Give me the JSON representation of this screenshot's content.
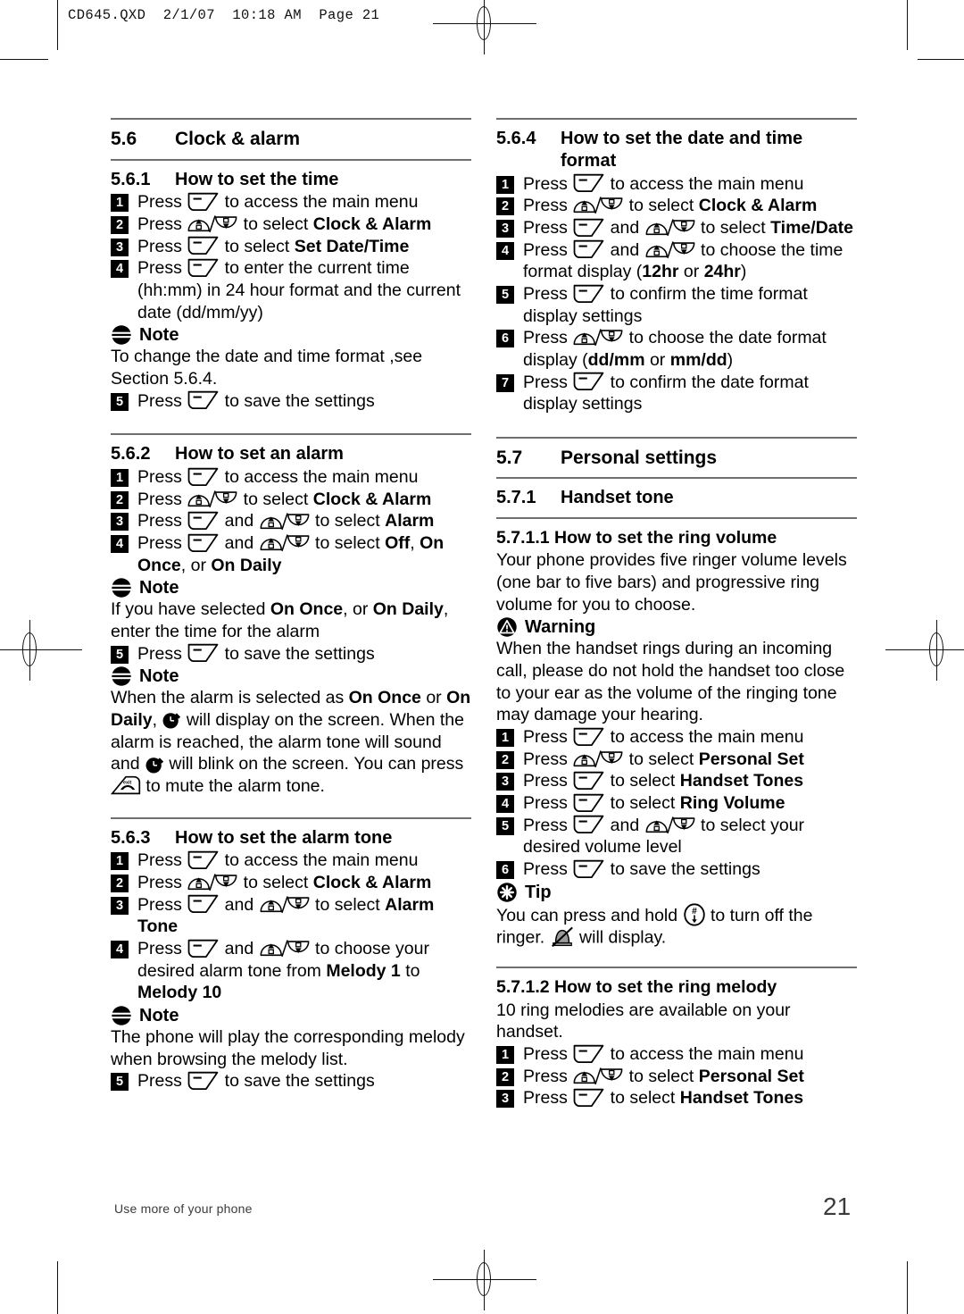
{
  "print_header": "CD645.QXD  2/1/07  10:18 AM  Page 21",
  "footer": {
    "left": "Use more of your phone",
    "page_number": "21"
  },
  "icons": {
    "soft_key": "soft-key-icon",
    "nav_up_down": "nav-up-down-key-icon",
    "clock": "alarm-clock-icon",
    "exit_key": "exit-key-icon",
    "hash_key": "hash-key-icon",
    "ringer_off": "ringer-off-icon",
    "note": "note-icon",
    "warning": "warning-icon",
    "tip": "tip-icon"
  },
  "left_column": {
    "section_56": {
      "number": "5.6",
      "title": "Clock & alarm"
    },
    "section_561": {
      "number": "5.6.1",
      "title": "How to set the time",
      "steps": [
        {
          "n": "1",
          "parts": [
            "Press ",
            "SOFT",
            " to access the main menu"
          ]
        },
        {
          "n": "2",
          "parts": [
            "Press ",
            "NAV",
            " to select ",
            "B:Clock & Alarm"
          ]
        },
        {
          "n": "3",
          "parts": [
            "Press ",
            "SOFT",
            " to select ",
            "B:Set Date/Time"
          ]
        },
        {
          "n": "4",
          "parts": [
            "Press ",
            "SOFT",
            " to enter the current time (hh:mm) in 24 hour format and the current date (dd/mm/yy)"
          ]
        }
      ],
      "note": {
        "label": "Note",
        "text": "To change the date and time format ,see Section 5.6.4."
      },
      "steps_after_note": [
        {
          "n": "5",
          "parts": [
            "Press ",
            "SOFT",
            " to save the settings"
          ]
        }
      ]
    },
    "section_562": {
      "number": "5.6.2",
      "title": "How to set an alarm",
      "steps": [
        {
          "n": "1",
          "parts": [
            "Press ",
            "SOFT",
            " to access the main menu"
          ]
        },
        {
          "n": "2",
          "parts": [
            "Press ",
            "NAV",
            " to select ",
            "B:Clock & Alarm"
          ]
        },
        {
          "n": "3",
          "parts": [
            "Press ",
            "SOFT",
            " and ",
            "NAV",
            " to select ",
            "B:Alarm"
          ]
        },
        {
          "n": "4",
          "parts": [
            "Press ",
            "SOFT",
            " and ",
            "NAV",
            " to select ",
            "B:Off",
            ", ",
            "B:On Once",
            ", or ",
            "B:On Daily"
          ]
        }
      ],
      "note1": {
        "label": "Note",
        "text_parts": [
          "If you have selected ",
          "B:On Once",
          ", or ",
          "B:On Daily",
          ", enter the time for the alarm"
        ]
      },
      "steps_after_note1": [
        {
          "n": "5",
          "parts": [
            "Press ",
            "SOFT",
            " to save the settings"
          ]
        }
      ],
      "note2": {
        "label": "Note",
        "text_parts": [
          "When the alarm is selected as ",
          "B:On Once",
          " or ",
          "B:On Daily",
          ", ",
          "CLOCK",
          " will display on the screen. When the alarm is reached, the alarm tone will sound and ",
          "CLOCK",
          " will blink on the screen. You can press ",
          "EXIT",
          " to mute the alarm tone."
        ]
      }
    },
    "section_563": {
      "number": "5.6.3",
      "title": "How to set the alarm tone",
      "steps": [
        {
          "n": "1",
          "parts": [
            "Press ",
            "SOFT",
            " to access the main menu"
          ]
        },
        {
          "n": "2",
          "parts": [
            "Press ",
            "NAV",
            " to select ",
            "B:Clock & Alarm"
          ]
        },
        {
          "n": "3",
          "parts": [
            "Press ",
            "SOFT",
            " and ",
            "NAV",
            " to select ",
            "B:Alarm Tone"
          ]
        },
        {
          "n": "4",
          "parts": [
            "Press ",
            "SOFT",
            " and ",
            "NAV",
            " to choose your desired alarm tone from ",
            "B:Melody 1",
            " to ",
            "B:Melody 10"
          ]
        }
      ],
      "note": {
        "label": "Note",
        "text": "The phone will play the corresponding melody when browsing the melody list."
      },
      "steps_after_note": [
        {
          "n": "5",
          "parts": [
            "Press ",
            "SOFT",
            " to save the settings"
          ]
        }
      ]
    }
  },
  "right_column": {
    "section_564": {
      "number": "5.6.4",
      "title": "How to set the date and time format",
      "steps": [
        {
          "n": "1",
          "parts": [
            "Press ",
            "SOFT",
            " to access the main menu"
          ]
        },
        {
          "n": "2",
          "parts": [
            "Press ",
            "NAV",
            " to select ",
            "B:Clock & Alarm"
          ]
        },
        {
          "n": "3",
          "parts": [
            "Press ",
            "SOFT",
            " and ",
            "NAV",
            " to select ",
            "B:Time/Date"
          ]
        },
        {
          "n": "4",
          "parts": [
            "Press ",
            "SOFT",
            " and ",
            "NAV",
            " to choose the time format display (",
            "B:12hr",
            " or ",
            "B:24hr",
            ")"
          ]
        },
        {
          "n": "5",
          "parts": [
            "Press ",
            "SOFT",
            " to confirm the time format display settings"
          ]
        },
        {
          "n": "6",
          "parts": [
            "Press ",
            "NAV",
            " to choose the date format display (",
            "B:dd/mm",
            " or ",
            "B:mm/dd",
            ")"
          ]
        },
        {
          "n": "7",
          "parts": [
            "Press ",
            "SOFT",
            " to confirm the date format display settings"
          ]
        }
      ]
    },
    "section_57": {
      "number": "5.7",
      "title": "Personal settings"
    },
    "section_571": {
      "number": "5.7.1",
      "title": "Handset tone"
    },
    "section_5711": {
      "title": "5.7.1.1 How to set the ring volume",
      "intro": "Your phone provides five ringer volume levels (one bar to five bars) and progressive ring volume for you to choose.",
      "warning": {
        "label": "Warning",
        "text": "When the handset rings during an incoming call, please do not hold the handset too close to your ear as the volume of the ringing tone may damage your hearing."
      },
      "steps": [
        {
          "n": "1",
          "parts": [
            "Press ",
            "SOFT",
            " to access the main menu"
          ]
        },
        {
          "n": "2",
          "parts": [
            "Press ",
            "NAV",
            " to select ",
            "B:Personal Set"
          ]
        },
        {
          "n": "3",
          "parts": [
            "Press ",
            "SOFT",
            " to select ",
            "B:Handset Tones"
          ]
        },
        {
          "n": "4",
          "parts": [
            "Press ",
            "SOFT",
            " to select ",
            "B:Ring Volume"
          ]
        },
        {
          "n": "5",
          "parts": [
            "Press ",
            "SOFT",
            " and ",
            "NAV",
            " to select your desired volume level"
          ]
        },
        {
          "n": "6",
          "parts": [
            "Press ",
            "SOFT",
            " to save the settings"
          ]
        }
      ],
      "tip": {
        "label": "Tip",
        "text_parts": [
          "You can press and hold ",
          "HASH",
          " to turn off the ringer. ",
          "MUTE",
          " will display."
        ]
      }
    },
    "section_5712": {
      "title": "5.7.1.2 How to set the ring melody",
      "intro": "10 ring melodies are available on your handset.",
      "steps": [
        {
          "n": "1",
          "parts": [
            "Press ",
            "SOFT",
            " to access the main menu"
          ]
        },
        {
          "n": "2",
          "parts": [
            "Press ",
            "NAV",
            " to select ",
            "B:Personal Set"
          ]
        },
        {
          "n": "3",
          "parts": [
            "Press ",
            "SOFT",
            " to select ",
            "B:Handset Tones"
          ]
        }
      ]
    }
  }
}
